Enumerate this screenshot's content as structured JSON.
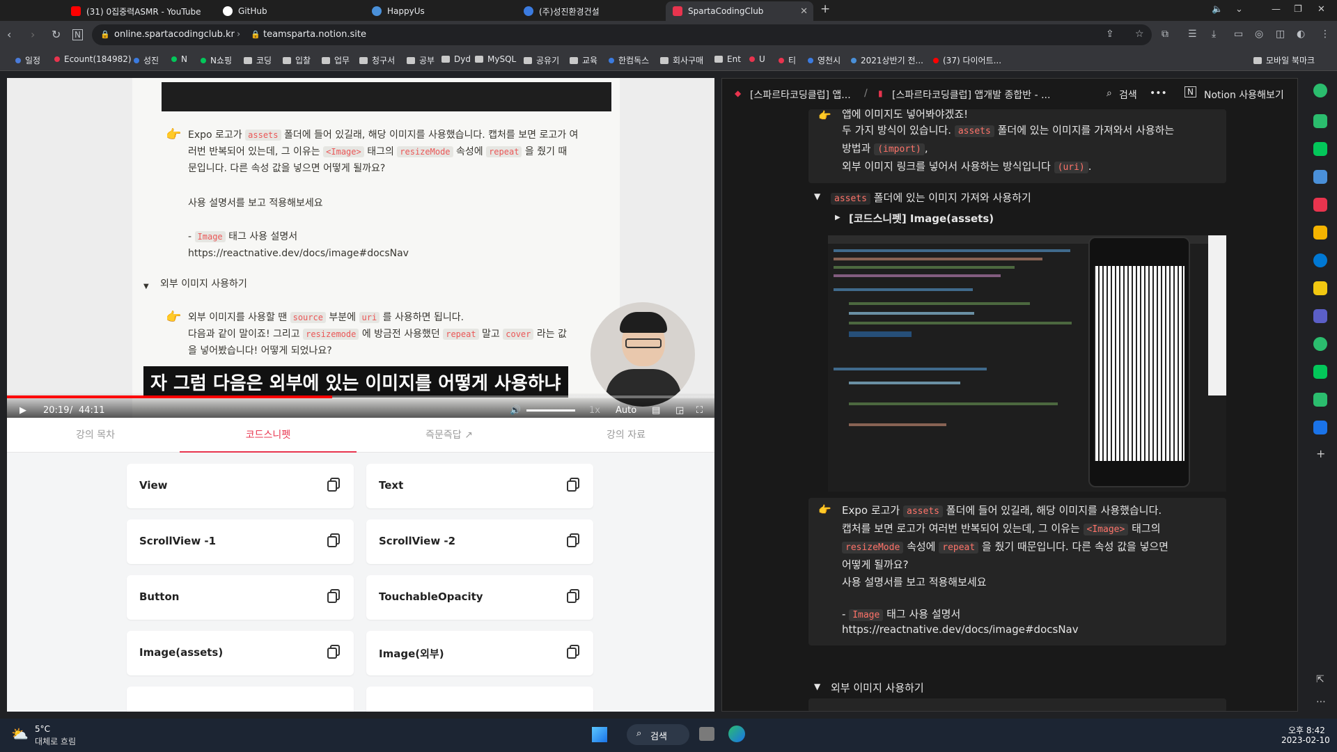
{
  "tabs": [
    {
      "title": "(31) 0집중력ASMR - YouTube",
      "color": "#ff0000"
    },
    {
      "title": "GitHub",
      "color": "#ffffff"
    },
    {
      "title": "HappyUs",
      "color": "#4a90d9"
    },
    {
      "title": "(주)성진환경건설",
      "color": "#3b7be0"
    },
    {
      "title": "SpartaCodingClub",
      "color": "#e8344e"
    }
  ],
  "address": {
    "site_badge": "online.spartacodingclub.kr",
    "url": "teamsparta.notion.site"
  },
  "bookmarks": [
    "일정",
    "Ecount(184982)",
    "성진",
    "N",
    "N쇼핑",
    "코딩",
    "입찰",
    "업무",
    "청구서",
    "공부",
    "Dyd",
    "MySQL",
    "공유기",
    "교육",
    "한컴독스",
    "회사구매",
    "Ent",
    "U",
    "티",
    "영천시",
    "2021상반기 전...",
    "(37) 다이어트...",
    "모바일 북마크"
  ],
  "video": {
    "callout1_a": "Expo 로고가",
    "callout1_code1": "assets",
    "callout1_b": "폴더에 들어 있길래, 해당 이미지를 사용했습니다. 캡처를 보면 로고가 여",
    "callout1_c": "러번 반복되어 있는데, 그 이유는",
    "callout1_code2": "<Image>",
    "callout1_d": "태그의",
    "callout1_code3": "resizeMode",
    "callout1_e": "속성에",
    "callout1_code4": "repeat",
    "callout1_f": "을 줬기 때",
    "callout1_g": "문입니다. 다른 속성 값을 넣으면 어떻게 될까요?",
    "callout1_h": "사용 설명서를 보고 적용해보세요",
    "callout1_i": "-",
    "callout1_code5": "Image",
    "callout1_j": "태그 사용 설명서",
    "callout1_link": "https://reactnative.dev/docs/image#docsNav",
    "toggle": "외부 이미지 사용하기",
    "callout2_a": "외부 이미지를 사용할 땐",
    "callout2_code1": "source",
    "callout2_b": "부분에",
    "callout2_code2": "uri",
    "callout2_c": "를 사용하면 됩니다.",
    "callout2_d": "다음과 같이 말이죠! 그리고",
    "callout2_code3": "resizemode",
    "callout2_e": "에 방금전 사용했던",
    "callout2_code4": "repeat",
    "callout2_f": "말고",
    "callout2_code5": "cover",
    "callout2_g": "라는 값",
    "callout2_h": "을 넣어봤습니다! 어떻게 되었나요?",
    "subtitle": "자 그럼 다음은 외부에 있는 이미지를 어떻게 사용하냐",
    "time_current": "20:19",
    "time_sep": "/",
    "time_total": "44:11",
    "speed": "1x",
    "quality": "Auto",
    "progress": 0.46
  },
  "lecture_tabs": [
    "강의 목차",
    "코드스니펫",
    "즉문즉답 ↗",
    "강의 자료"
  ],
  "snippets": [
    "View",
    "Text",
    "ScrollView -1",
    "ScrollView -2",
    "Button",
    "TouchableOpacity",
    "Image(assets)",
    "Image(외부)"
  ],
  "notion": {
    "breadcrumb1": "[스파르타코딩클럽] 앱...",
    "breadcrumb_sep": "/",
    "breadcrumb2": "[스파르타코딩클럽] 앱개발 종합반 - ...",
    "search": "검색",
    "more": "•••",
    "cta": "Notion 사용해보기",
    "top_cut": "앱에 이미지도 넣어봐야겠죠!",
    "p1_a": "두 가지 방식이 있습니다.",
    "p1_code1": "assets",
    "p1_b": "폴더에 있는 이미지를 가져와서 사용하는",
    "p1_c": "방법과",
    "p1_code2": "(import)",
    "p1_d": ",",
    "p1_e": "외부 이미지 링크를 넣어서 사용하는 방식입니다",
    "p1_code3": "(uri)",
    "p1_f": ".",
    "toggle1_code": "assets",
    "toggle1_text": "폴더에 있는 이미지 가져와 사용하기",
    "toggle2": "[코드스니펫] Image(assets)",
    "c_a": "Expo 로고가",
    "c_code1": "assets",
    "c_b": "폴더에 들어 있길래, 해당 이미지를 사용했습니다.",
    "c_c": "캡처를 보면 로고가 여러번 반복되어 있는데, 그 이유는",
    "c_code2": "<Image>",
    "c_d": "태그의",
    "c_code3": "resizeMode",
    "c_e": "속성에",
    "c_code4": "repeat",
    "c_f": "을 줬기 때문입니다. 다른 속성 값을 넣으면",
    "c_g": "어떻게 될까요?",
    "c_h": "사용 설명서를 보고 적용해보세요",
    "c_i": "-",
    "c_code5": "Image",
    "c_j": "태그 사용 설명서",
    "c_link": "https://reactnative.dev/docs/image#docsNav",
    "toggle3": "외부 이미지 사용하기"
  },
  "taskbar": {
    "weather_temp": "5°C",
    "weather_desc": "대체로 흐림",
    "search": "검색",
    "time": "오후 8:42",
    "date": "2023-02-10"
  }
}
